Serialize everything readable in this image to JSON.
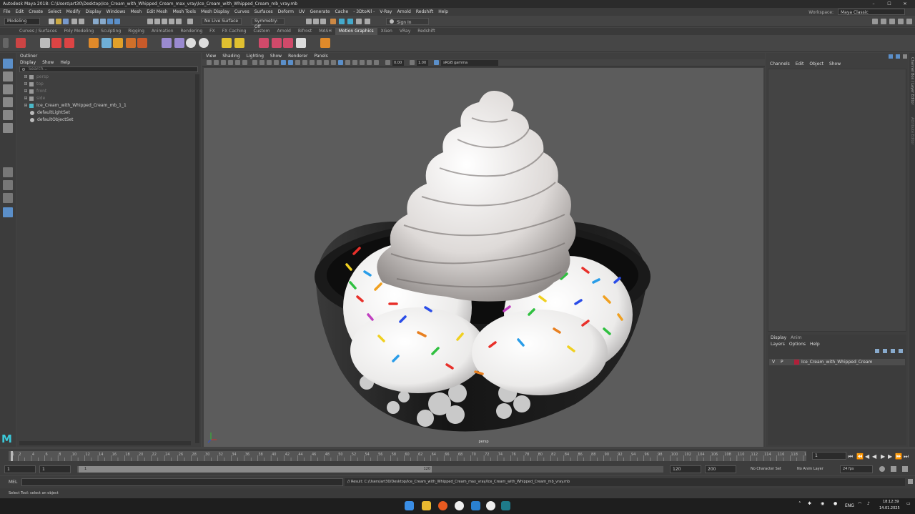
{
  "window": {
    "title": "Autodesk Maya 2018: C:\\Users\\art30\\Desktop\\Ice_Cream_with_Whipped_Cream_max_vray\\Ice_Cream_with_Whipped_Cream_mb_vray.mb",
    "minimize": "–",
    "maximize": "☐",
    "close": "✕"
  },
  "workspace": {
    "label": "Workspace:",
    "value": "Maya Classic"
  },
  "menubar": [
    "File",
    "Edit",
    "Create",
    "Select",
    "Modify",
    "Display",
    "Windows",
    "Mesh",
    "Edit Mesh",
    "Mesh Tools",
    "Mesh Display",
    "Curves",
    "Surfaces",
    "Deform",
    "UV",
    "Generate",
    "Cache",
    "- 3DtoAll -",
    "V-Ray",
    "Arnold",
    "Redshift",
    "Help"
  ],
  "statusline": {
    "mode": "Modeling",
    "live_surface": "No Live Surface",
    "symmetry": "Symmetry: Off",
    "sign_in": "Sign In"
  },
  "shelf_tabs": [
    "Curves / Surfaces",
    "Poly Modeling",
    "Sculpting",
    "Rigging",
    "Animation",
    "Rendering",
    "FX",
    "FX Caching",
    "Custom",
    "Arnold",
    "Bifrost",
    "MASH",
    "Motion Graphics",
    "XGen",
    "VRay",
    "Redshift"
  ],
  "shelf_active": "Motion Graphics",
  "outliner": {
    "title": "Outliner",
    "menu": [
      "Display",
      "Show",
      "Help"
    ],
    "search_placeholder": "Search...",
    "items": [
      {
        "label": "persp",
        "dim": true
      },
      {
        "label": "top",
        "dim": true
      },
      {
        "label": "front",
        "dim": true
      },
      {
        "label": "side",
        "dim": true
      },
      {
        "label": "Ice_Cream_with_Whipped_Cream_mb_1_1",
        "dim": false
      },
      {
        "label": "defaultLightSet",
        "dim": false
      },
      {
        "label": "defaultObjectSet",
        "dim": false
      }
    ]
  },
  "viewport": {
    "menu": [
      "View",
      "Shading",
      "Lighting",
      "Show",
      "Renderer",
      "Panels"
    ],
    "exposure": "0.00",
    "gamma": "1.00",
    "colorspace": "sRGB gamma",
    "camera": "persp"
  },
  "channelbox": {
    "menu": [
      "Channels",
      "Edit",
      "Object",
      "Show"
    ]
  },
  "layer_editor": {
    "tabs": [
      "Display",
      "Anim"
    ],
    "menu": [
      "Layers",
      "Options",
      "Help"
    ],
    "layer": {
      "v": "V",
      "p": "P",
      "name": "Ice_Cream_with_Whipped_Cream",
      "color": "#b0203a"
    }
  },
  "side_tabs": [
    "Channel Box / Layer Editor",
    "Attribute Editor"
  ],
  "timeline": {
    "ticks": [
      "1",
      "2",
      "4",
      "6",
      "8",
      "10",
      "12",
      "14",
      "16",
      "18",
      "20",
      "22",
      "24",
      "26",
      "28",
      "30",
      "32",
      "34",
      "36",
      "38",
      "40",
      "42",
      "44",
      "46",
      "48",
      "50",
      "52",
      "54",
      "56",
      "58",
      "60",
      "62",
      "64",
      "66",
      "68",
      "70",
      "72",
      "74",
      "76",
      "78",
      "80",
      "82",
      "84",
      "86",
      "88",
      "90",
      "92",
      "94",
      "96",
      "98",
      "100",
      "102",
      "104",
      "106",
      "108",
      "110",
      "112",
      "114",
      "116",
      "118",
      "120"
    ],
    "current_frame": "1"
  },
  "range": {
    "start": "1",
    "anim_start": "1",
    "range_start_label": "1",
    "range_end_label": "120",
    "end": "120",
    "anim_end": "200",
    "character_set": "No Character Set",
    "anim_layer": "No Anim Layer",
    "fps": "24 fps"
  },
  "cmdline": {
    "label": "MEL",
    "result": "// Result: C:/Users/art30/Desktop/Ice_Cream_with_Whipped_Cream_max_vray/Ice_Cream_with_Whipped_Cream_mb_vray.mb"
  },
  "helpline": "Select Tool: select an object",
  "taskbar": {
    "lang": "ENG",
    "time": "18:12:39",
    "date": "14.01.2025"
  }
}
